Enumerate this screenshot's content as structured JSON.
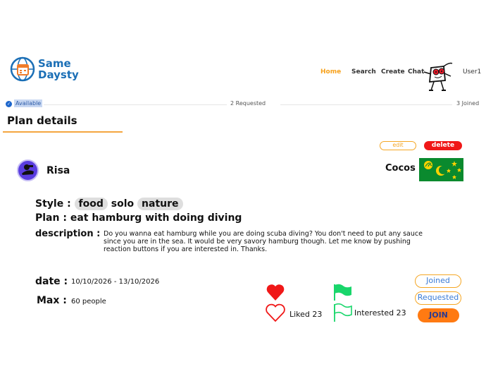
{
  "header": {
    "logo_line1": "Same",
    "logo_line2": "Daysty",
    "nav": [
      "Home",
      "Search",
      "Create",
      "Chat"
    ],
    "user": "User1"
  },
  "steps": {
    "available": "Available",
    "requested": "2  Requested",
    "joined": "3  Joined"
  },
  "page_title": "Plan details",
  "owner": {
    "edit_label": "edit",
    "delete_label": "delete",
    "name": "Risa",
    "country": "Cocos"
  },
  "plan": {
    "style_label": "Style :",
    "style_tags": [
      "food",
      "solo",
      "nature"
    ],
    "plan_label": "Plan :",
    "plan_text": "eat hamburg with doing diving",
    "description_label": "description :",
    "description": "Do you wanna eat hamburg while you are doing scuba diving? You don't need to put any sauce since you are in the sea. It would be very savory hamburg though. Let me know by pushing reaction buttons if you are interested in. Thanks.",
    "date_label": "date :",
    "date_value": "10/10/2026 - 13/10/2026",
    "max_label": "Max :",
    "max_value": "60 people"
  },
  "reactions": {
    "liked_label": "Liked 23",
    "interested_label": "Interested 23"
  },
  "actions": {
    "joined": "Joined",
    "requested": "Requested",
    "join": "JOIN"
  },
  "colors": {
    "accent": "#f5a623",
    "brand": "#1b6fb6",
    "delete": "#f01818",
    "join": "#ff7a12",
    "like": "#f01818",
    "interest": "#19d66b"
  }
}
